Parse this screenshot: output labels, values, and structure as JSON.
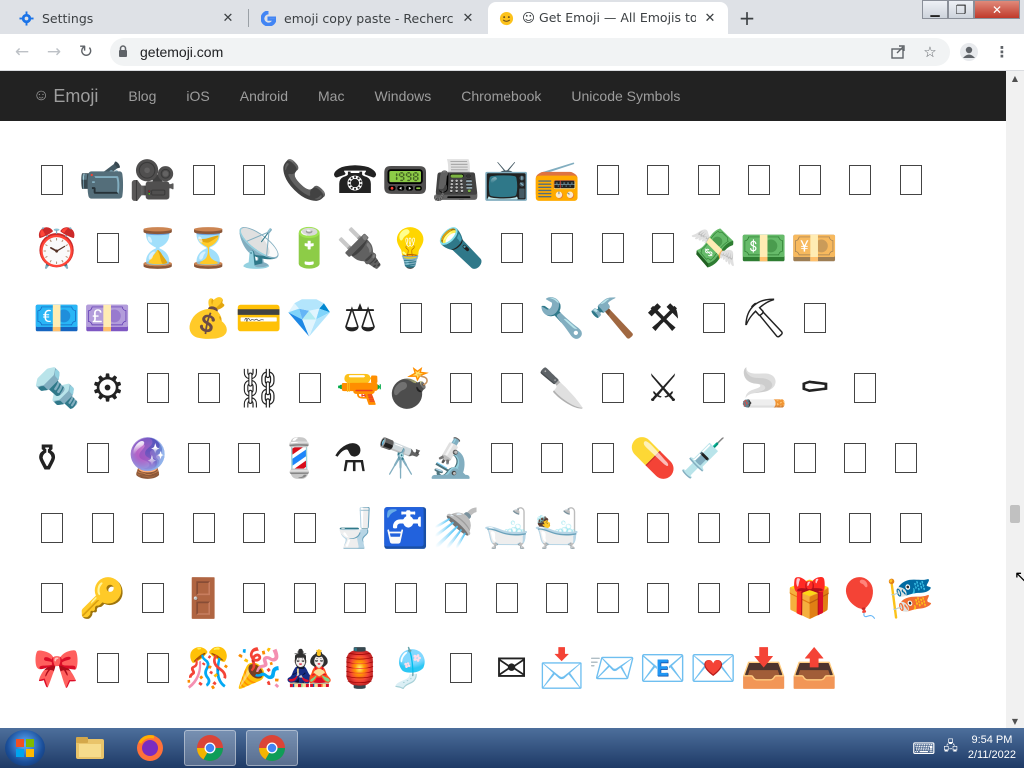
{
  "browser": {
    "tabs": [
      {
        "title": "Settings",
        "icon": "gear-icon",
        "active": false
      },
      {
        "title": "emoji copy paste - Recherche Google",
        "icon": "google-icon",
        "active": false
      },
      {
        "title": "☺ Get Emoji — All Emojis to ✂️ Copy and Paste",
        "icon": "smiley-icon",
        "active": true
      }
    ],
    "url": "getemoji.com",
    "new_tab_label": "+"
  },
  "site": {
    "brand": "Emoji",
    "brand_icon": "☺",
    "nav": [
      "Blog",
      "iOS",
      "Android",
      "Mac",
      "Windows",
      "Chromebook",
      "Unicode Symbols"
    ]
  },
  "emoji_rows": [
    {
      "items": [
        "",
        "📹",
        "🎥",
        "",
        "",
        "📞",
        "☎",
        "📟",
        "📠",
        "📺",
        "📻",
        "",
        "",
        "",
        "",
        "",
        "",
        ""
      ]
    },
    {
      "items": [
        "⏰",
        "",
        "⌛",
        "⏳",
        "📡",
        "🔋",
        "🔌",
        "💡",
        "🔦",
        "",
        "",
        "",
        "",
        "💸",
        "💵",
        "💴"
      ]
    },
    {
      "items": [
        "💶",
        "💷",
        "",
        "💰",
        "💳",
        "💎",
        "⚖",
        "",
        "",
        "",
        "🔧",
        "🔨",
        "⚒",
        "",
        "⛏",
        ""
      ]
    },
    {
      "items": [
        "🔩",
        "⚙",
        "",
        "",
        "⛓",
        "",
        "🔫",
        "💣",
        "",
        "",
        "🔪",
        "",
        "⚔",
        "",
        "🚬",
        "⚰",
        ""
      ]
    },
    {
      "items": [
        "⚱",
        "",
        "🔮",
        "",
        "",
        "💈",
        "⚗",
        "🔭",
        "🔬",
        "",
        "",
        "",
        "💊",
        "💉",
        "",
        "",
        "",
        ""
      ]
    },
    {
      "items": [
        "",
        "",
        "",
        "",
        "",
        "",
        "🚽",
        "🚰",
        "🚿",
        "🛁",
        "🛀",
        "",
        "",
        "",
        "",
        "",
        "",
        ""
      ]
    },
    {
      "items": [
        "",
        "🔑",
        "",
        "🚪",
        "",
        "",
        "",
        "",
        "",
        "",
        "",
        "",
        "",
        "",
        "",
        "🎁",
        "🎈",
        "🎏"
      ]
    },
    {
      "items": [
        "🎀",
        "",
        "",
        "🎊",
        "🎉",
        "🎎",
        "🏮",
        "🎐",
        "",
        "✉",
        "📩",
        "📨",
        "📧",
        "💌",
        "📥",
        "📤"
      ]
    }
  ],
  "taskbar": {
    "time": "9:54 PM",
    "date": "2/11/2022"
  }
}
